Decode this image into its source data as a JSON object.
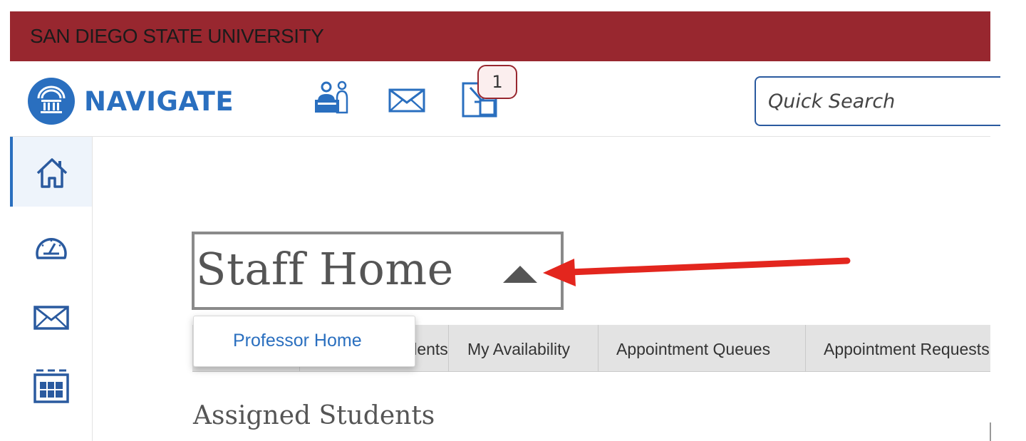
{
  "header": {
    "university_name": "SAN DIEGO STATE UNIVERSITY",
    "university_bar_color": "#98272f"
  },
  "topnav": {
    "brand": "NAVIGATE",
    "brand_color": "#2a6fbf",
    "icons": [
      "institution-logo-icon",
      "student-desk-icon",
      "mail-icon",
      "download-inbox-icon"
    ],
    "notification_count": "1",
    "search_placeholder": "Quick Search"
  },
  "sidebar": {
    "items": [
      {
        "name": "home-icon",
        "active": true
      },
      {
        "name": "dashboard-gauge-icon",
        "active": false
      },
      {
        "name": "mail-icon",
        "active": false
      },
      {
        "name": "calendar-icon",
        "active": false
      }
    ]
  },
  "main": {
    "page_title": "Staff Home",
    "dropdown_option": "Professor Home",
    "tabs": [
      {
        "label": "Assigned Students"
      },
      {
        "label": "My Availability"
      },
      {
        "label": "Appointment Queues"
      },
      {
        "label": "Appointment Requests"
      }
    ],
    "section_title": "Assigned Students"
  },
  "annotation": {
    "arrow_color": "#e3261e"
  }
}
